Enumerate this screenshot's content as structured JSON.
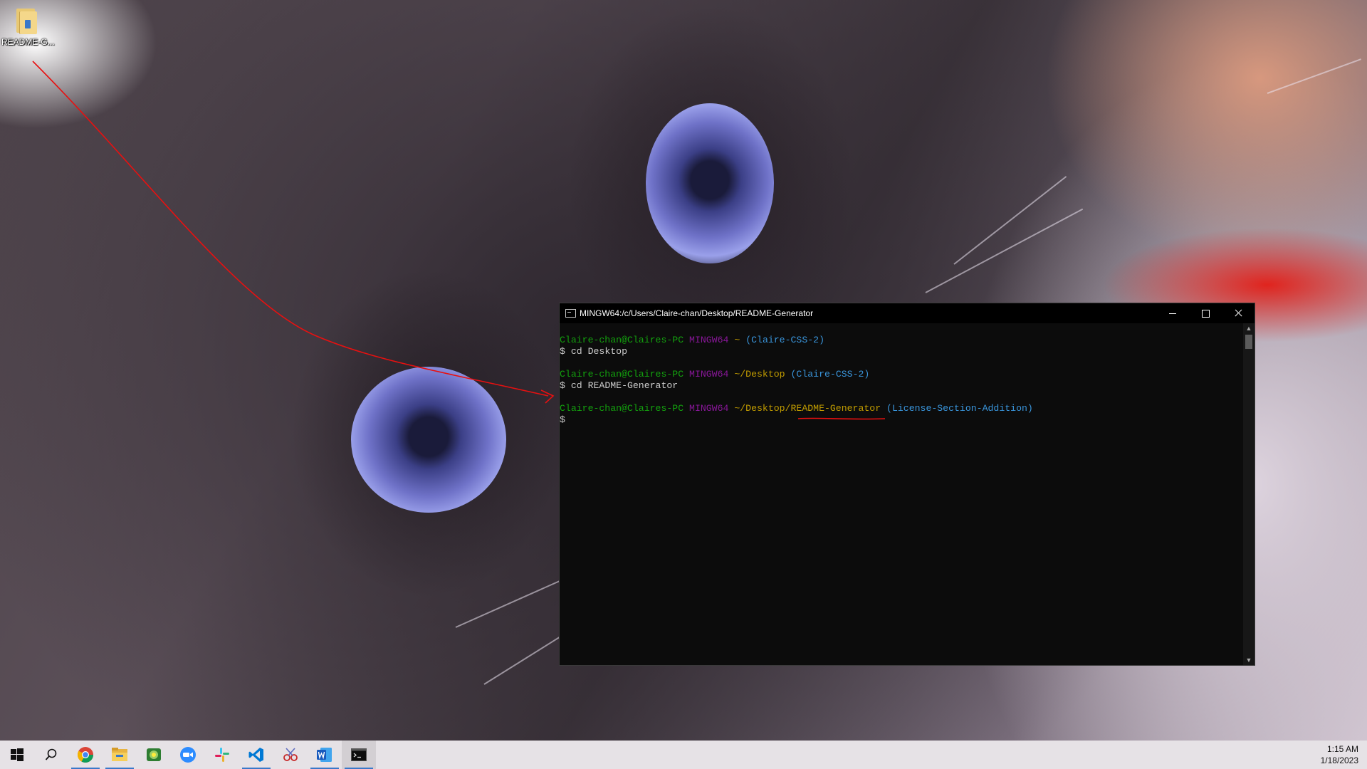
{
  "desktop": {
    "icons": [
      {
        "label": "README-G..."
      }
    ]
  },
  "terminal": {
    "title": "MINGW64:/c/Users/Claire-chan/Desktop/README-Generator",
    "lines": [
      {
        "user": "Claire-chan@Claires-PC",
        "env": "MINGW64",
        "path": "~",
        "branch": "(Claire-CSS-2)"
      },
      {
        "prompt": "$",
        "command": "cd Desktop"
      },
      {
        "user": "Claire-chan@Claires-PC",
        "env": "MINGW64",
        "path": "~/Desktop",
        "branch": "(Claire-CSS-2)"
      },
      {
        "prompt": "$",
        "command": "cd README-Generator"
      },
      {
        "user": "Claire-chan@Claires-PC",
        "env": "MINGW64",
        "path_prefix": "~/Desktop/",
        "path_highlight": "README-Generator",
        "branch": "(License-Section-Addition)"
      },
      {
        "prompt": "$",
        "command": ""
      }
    ]
  },
  "taskbar": {
    "items": [
      {
        "icon": "windows-start-icon",
        "active": false
      },
      {
        "icon": "search-icon",
        "active": false
      },
      {
        "icon": "chrome-icon",
        "active": true
      },
      {
        "icon": "file-explorer-icon",
        "active": true
      },
      {
        "icon": "photos-app-icon",
        "active": false
      },
      {
        "icon": "zoom-icon",
        "active": false
      },
      {
        "icon": "slack-icon",
        "active": false
      },
      {
        "icon": "vscode-icon",
        "active": true
      },
      {
        "icon": "snipping-tool-icon",
        "active": false
      },
      {
        "icon": "word-icon",
        "active": true
      },
      {
        "icon": "terminal-icon",
        "active": true
      }
    ],
    "clock": {
      "time": "1:15 AM",
      "date": "1/18/2023"
    }
  },
  "colors": {
    "terminal_bg": "#0c0c0c",
    "user_green": "#13a10e",
    "env_purple": "#881798",
    "path_yellow": "#c19c00",
    "branch_cyan": "#3a96dd",
    "annotation_red": "#e81010",
    "taskbar_bg": "#e6e2e6"
  }
}
